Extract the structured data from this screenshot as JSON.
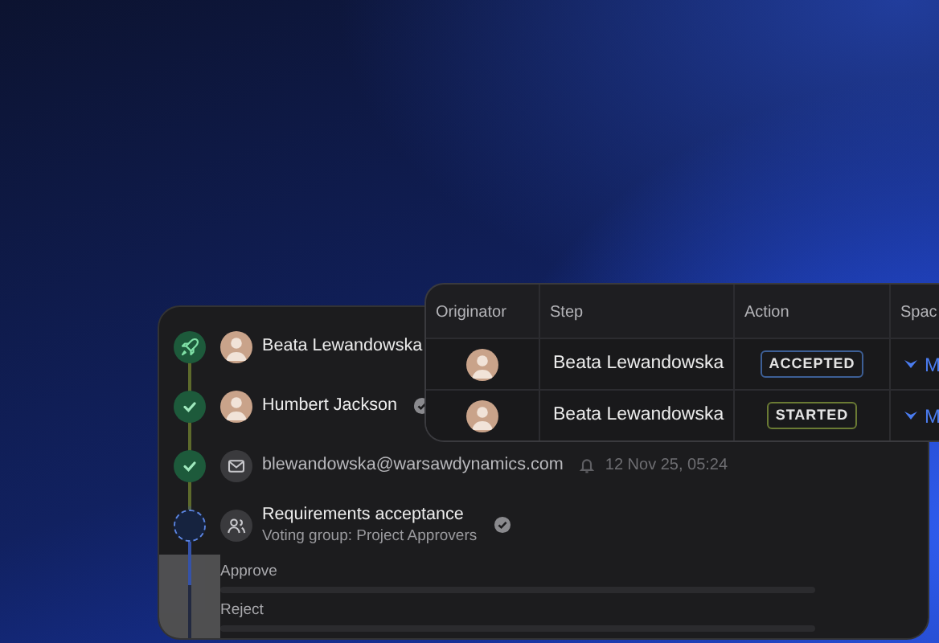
{
  "timeline": [
    {
      "kind": "origin",
      "completed": true,
      "name": "Beata Lewandowska",
      "verified": false
    },
    {
      "kind": "person",
      "completed": true,
      "name": "Humbert Jackson",
      "verified": true
    },
    {
      "kind": "email",
      "completed": true,
      "email": "blewandowska@warsawdynamics.com",
      "time": "12 Nov 25, 05:24"
    },
    {
      "kind": "group",
      "completed": false,
      "title": "Requirements acceptance",
      "subtitle": "Voting group: Project Approvers",
      "verified": true
    }
  ],
  "votes": [
    {
      "label": "Approve",
      "level": 0
    },
    {
      "label": "Reject",
      "level": 0
    }
  ],
  "table": {
    "columns": [
      "Originator",
      "Step",
      "Action",
      "Spac"
    ],
    "rows": [
      {
        "step": "Beata Lewandowska",
        "action": "ACCEPTED",
        "color": "#3d5f96",
        "space": "M"
      },
      {
        "step": "Beata Lewandowska",
        "action": "STARTED",
        "color": "#6a7a34",
        "space": "M"
      }
    ]
  }
}
